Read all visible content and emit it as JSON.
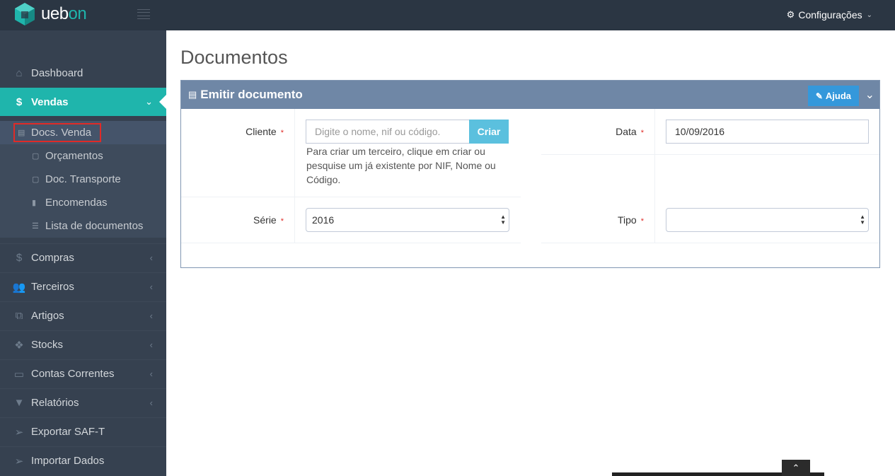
{
  "app": {
    "logo_text": "ueb",
    "logo_accent": "on",
    "config_label": "Configurações"
  },
  "sidebar": {
    "items": [
      {
        "label": "Dashboard",
        "icon": "home-icon"
      },
      {
        "label": "Vendas",
        "icon": "dollar-icon"
      },
      {
        "label": "Compras",
        "icon": "dollar-icon"
      },
      {
        "label": "Terceiros",
        "icon": "users-icon"
      },
      {
        "label": "Artigos",
        "icon": "sitemap-icon"
      },
      {
        "label": "Stocks",
        "icon": "cubes-icon"
      },
      {
        "label": "Contas Correntes",
        "icon": "credit-card-icon"
      },
      {
        "label": "Relatórios",
        "icon": "filter-icon"
      },
      {
        "label": "Exportar SAF-T",
        "icon": "send-icon"
      },
      {
        "label": "Importar Dados",
        "icon": "send-icon"
      }
    ],
    "vendas_sub": [
      {
        "label": "Docs. Venda",
        "icon": "document-icon"
      },
      {
        "label": "Orçamentos",
        "icon": "document-icon"
      },
      {
        "label": "Doc. Transporte",
        "icon": "document-icon"
      },
      {
        "label": "Encomendas",
        "icon": "file-icon"
      },
      {
        "label": "Lista de documentos",
        "icon": "list-icon"
      }
    ]
  },
  "main": {
    "page_title": "Documentos",
    "portlet": {
      "title": "Emitir documento",
      "help_label": "Ajuda"
    },
    "form": {
      "cliente_label": "Cliente",
      "cliente_placeholder": "Digite o nome, nif ou código.",
      "criar_label": "Criar",
      "cliente_help": "Para criar um terceiro, clique em criar ou pesquise um já existente por NIF, Nome ou Código.",
      "data_label": "Data",
      "data_value": "10/09/2016",
      "serie_label": "Série",
      "serie_value": "2016",
      "tipo_label": "Tipo",
      "tipo_value": "",
      "required_mark": "*"
    }
  },
  "colors": {
    "topbar": "#2b3643",
    "sidebar": "#364150",
    "active": "#1fb5ac",
    "portlet_head": "#6f87a6",
    "help_button": "#3498db",
    "criar_button": "#5bc0de",
    "required": "#e02b27"
  }
}
